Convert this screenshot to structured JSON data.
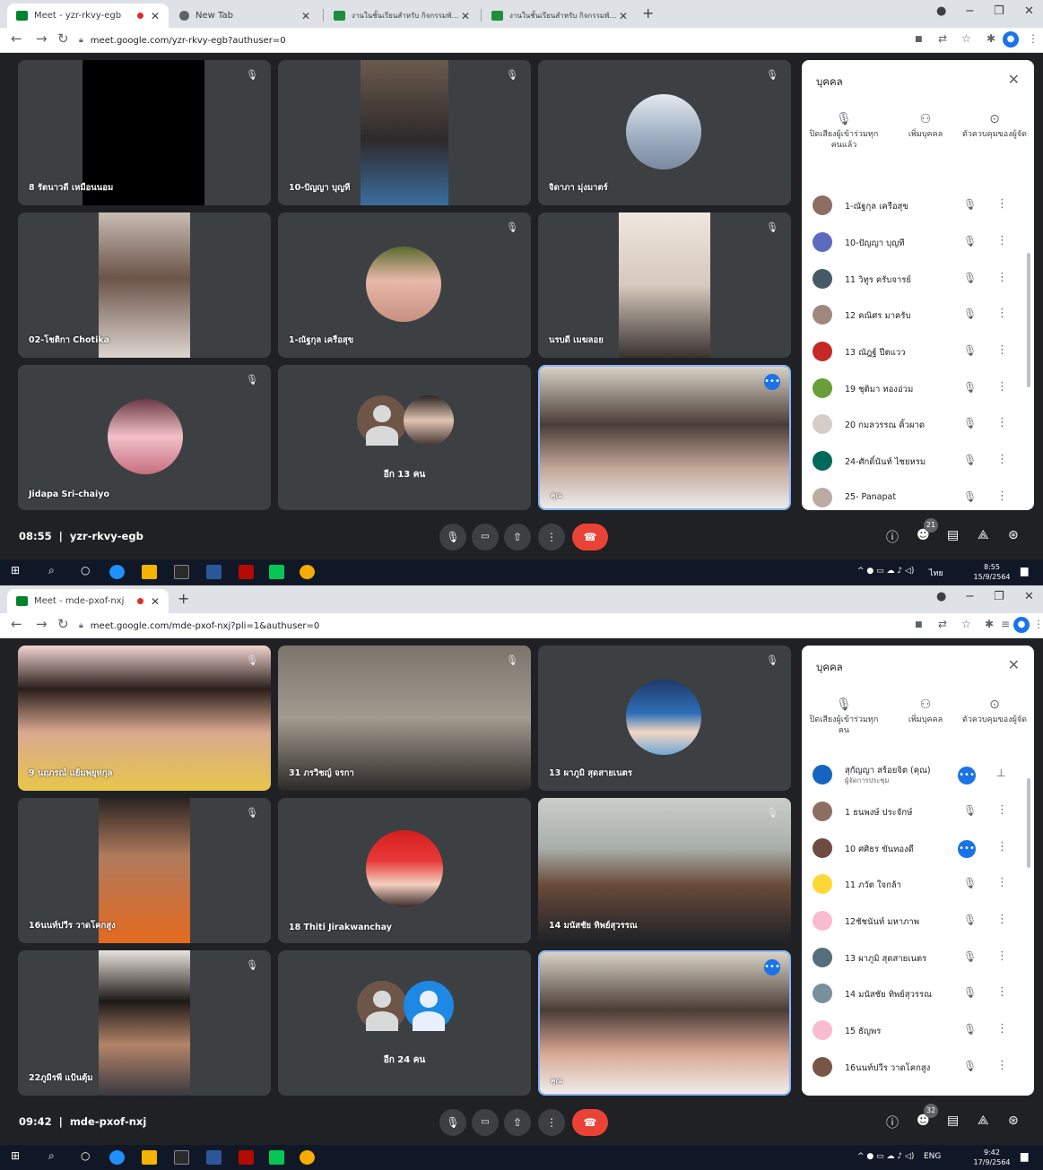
{
  "top": {
    "tabs": [
      {
        "title": "Meet - yzr-rkvy-egb",
        "active": true
      },
      {
        "title": "New Tab",
        "active": false
      },
      {
        "title": "งานในชั้นเรียนสำหรับ กิจกรรมพัฒนาผู้เรียน",
        "active": false
      },
      {
        "title": "งานในชั้นเรียนสำหรับ กิจกรรมพัฒนาผู้เรียน",
        "active": false
      }
    ],
    "url": "meet.google.com/yzr-rkvy-egb?authuser=0",
    "tiles": [
      {
        "name": "8 รัตนาวดี เหมือนนอม"
      },
      {
        "name": "10-ปัญญา บุญที"
      },
      {
        "name": "จิดาภา มุ่งมาตร์"
      },
      {
        "name": "02-โชติกา Chotika"
      },
      {
        "name": "1-ณัฐกุล เครือสุข"
      },
      {
        "name": "นรบดี เมฆลอย"
      },
      {
        "name": "Jidapa Sri-chaiyo"
      },
      {
        "name": "อีก 13 คน"
      },
      {
        "name": "คุณ"
      }
    ],
    "panel": {
      "title": "บุคคล",
      "actions": [
        "ปิดเสียงผู้เข้าร่วมทุกคนแล้ว",
        "เพิ่มบุคคล",
        "ตัวควบคุมของผู้จัด"
      ],
      "people": [
        {
          "name": "1-ณัฐกุล เครือสุข",
          "color": "#8d6e63"
        },
        {
          "name": "10-ปัญญา บุญที",
          "color": "#5c6bc0"
        },
        {
          "name": "11 วิทูร ครับจารย์",
          "color": "#455a64"
        },
        {
          "name": "12 คณิศร มาครับ",
          "color": "#a1887f"
        },
        {
          "name": "13 ณัฎฐ์ ปีตแวว",
          "color": "#c62828"
        },
        {
          "name": "19 ชุติมา ทองอ่วม",
          "color": "#689f38"
        },
        {
          "name": "20 กมลวรรณ คิ้วผาด",
          "color": "#d7ccc8"
        },
        {
          "name": "24-ศักดิ์นันท์ ไชยหรม",
          "color": "#00695c"
        },
        {
          "name": "25- Panapat",
          "color": "#bcaaa4"
        }
      ]
    },
    "meeting": {
      "time": "08:55",
      "code": "yzr-rkvy-egb",
      "people_count": "21"
    },
    "taskbar": {
      "lang": "ไทย",
      "time": "8:55",
      "date": "15/9/2564"
    }
  },
  "bottom": {
    "tabs": [
      {
        "title": "Meet - mde-pxof-nxj",
        "active": true
      }
    ],
    "url": "meet.google.com/mde-pxof-nxj?pli=1&authuser=0",
    "tiles": [
      {
        "name": "9 นฤภรณ์ แย้มพยุหกุล"
      },
      {
        "name": "31 ภรวิชญ์ จรกา"
      },
      {
        "name": "13 ผาภูมิ สุดสายเนตร"
      },
      {
        "name": "16นนท์ปวีร วาดโคกสูง"
      },
      {
        "name": "18 Thiti Jirakwanchay"
      },
      {
        "name": "14 มนัสชัย ทิพย์สุวรรณ"
      },
      {
        "name": "22ภูมิรพี แป้นตุ้ม"
      },
      {
        "name": "อีก 24 คน"
      },
      {
        "name": "คุณ"
      }
    ],
    "panel": {
      "title": "บุคคล",
      "actions": [
        "ปิดเสียงผู้เข้าร่วมทุกคน",
        "เพิ่มบุคคล",
        "ตัวควบคุมของผู้จัด"
      ],
      "host": {
        "name": "สุกัญญา สร้อยจิต (คุณ)",
        "sub": "ผู้จัดการประชุม"
      },
      "people": [
        {
          "name": "1 ธนพงษ์ ประจักษ์",
          "color": "#8d6e63"
        },
        {
          "name": "10 ศศิธร ขันทองดี",
          "color": "#6d4c41"
        },
        {
          "name": "11 ภวัต ใจกล้า",
          "color": "#fdd835"
        },
        {
          "name": "12ชัชนันท์ มหาภาพ",
          "color": "#f8bbd0"
        },
        {
          "name": "13 ผาภูมิ สุดสายเนตร",
          "color": "#546e7a"
        },
        {
          "name": "14 มนัสชัย ทิพย์สุวรรณ",
          "color": "#78909c"
        },
        {
          "name": "15 ธัญพร",
          "color": "#f8bbd0"
        },
        {
          "name": "16นนท์ปวีร วาดโคกสูง",
          "color": "#795548"
        }
      ]
    },
    "meeting": {
      "time": "09:42",
      "code": "mde-pxof-nxj",
      "people_count": "32"
    },
    "taskbar": {
      "lang": "ENG",
      "time": "9:42",
      "date": "17/9/2564"
    }
  },
  "icons": {
    "mic_off": "mic-off-icon",
    "more": "more-options-icon",
    "close": "close-icon",
    "info": "info-icon",
    "people": "people-icon",
    "chat": "chat-icon",
    "activities": "activities-icon",
    "lock": "lock-icon"
  },
  "colors": {
    "meet_bg": "#202124",
    "tile_bg": "#3c4043",
    "hangup": "#ea4335",
    "accent": "#1a73e8"
  }
}
